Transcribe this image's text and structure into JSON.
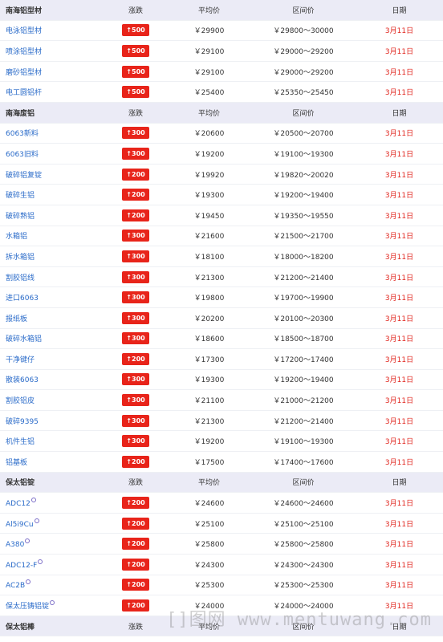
{
  "columns": {
    "change": "涨跌",
    "avg": "平均价",
    "range": "区间价",
    "date": "日期"
  },
  "sections": [
    {
      "title": "南海铝型材",
      "rows": [
        {
          "name": "电泳铝型材",
          "change": "↑500",
          "avg": "￥29900",
          "range": "￥29800～30000",
          "date": "3月11日"
        },
        {
          "name": "喷涂铝型材",
          "change": "↑500",
          "avg": "￥29100",
          "range": "￥29000～29200",
          "date": "3月11日"
        },
        {
          "name": "磨砂铝型材",
          "change": "↑500",
          "avg": "￥29100",
          "range": "￥29000～29200",
          "date": "3月11日"
        },
        {
          "name": "电工圆铝杆",
          "change": "↑500",
          "avg": "￥25400",
          "range": "￥25350～25450",
          "date": "3月11日"
        }
      ]
    },
    {
      "title": "南海废铝",
      "rows": [
        {
          "name": "6063新料",
          "change": "↑300",
          "avg": "￥20600",
          "range": "￥20500～20700",
          "date": "3月11日"
        },
        {
          "name": "6063旧料",
          "change": "↑300",
          "avg": "￥19200",
          "range": "￥19100～19300",
          "date": "3月11日"
        },
        {
          "name": "破碎铝复锭",
          "change": "↑200",
          "avg": "￥19920",
          "range": "￥19820～20020",
          "date": "3月11日"
        },
        {
          "name": "破碎生铝",
          "change": "↑200",
          "avg": "￥19300",
          "range": "￥19200～19400",
          "date": "3月11日"
        },
        {
          "name": "破碎熟铝",
          "change": "↑200",
          "avg": "￥19450",
          "range": "￥19350～19550",
          "date": "3月11日"
        },
        {
          "name": "水箱铝",
          "change": "↑300",
          "avg": "￥21600",
          "range": "￥21500～21700",
          "date": "3月11日"
        },
        {
          "name": "拆水箱铝",
          "change": "↑300",
          "avg": "￥18100",
          "range": "￥18000～18200",
          "date": "3月11日"
        },
        {
          "name": "割胶铝线",
          "change": "↑300",
          "avg": "￥21300",
          "range": "￥21200～21400",
          "date": "3月11日"
        },
        {
          "name": "进口6063",
          "change": "↑300",
          "avg": "￥19800",
          "range": "￥19700～19900",
          "date": "3月11日"
        },
        {
          "name": "报纸板",
          "change": "↑300",
          "avg": "￥20200",
          "range": "￥20100～20300",
          "date": "3月11日"
        },
        {
          "name": "破碎水箱铝",
          "change": "↑300",
          "avg": "￥18600",
          "range": "￥18500～18700",
          "date": "3月11日"
        },
        {
          "name": "干净键仔",
          "change": "↑200",
          "avg": "￥17300",
          "range": "￥17200～17400",
          "date": "3月11日"
        },
        {
          "name": "散装6063",
          "change": "↑300",
          "avg": "￥19300",
          "range": "￥19200～19400",
          "date": "3月11日"
        },
        {
          "name": "割胶铝皮",
          "change": "↑300",
          "avg": "￥21100",
          "range": "￥21000～21200",
          "date": "3月11日"
        },
        {
          "name": "破碎9395",
          "change": "↑300",
          "avg": "￥21300",
          "range": "￥21200～21400",
          "date": "3月11日"
        },
        {
          "name": "机件生铝",
          "change": "↑300",
          "avg": "￥19200",
          "range": "￥19100～19300",
          "date": "3月11日"
        },
        {
          "name": "铝基板",
          "change": "↑200",
          "avg": "￥17500",
          "range": "￥17400～17600",
          "date": "3月11日"
        }
      ]
    },
    {
      "title": "保太铝锭",
      "rows": [
        {
          "name": "ADC12",
          "change": "↑200",
          "avg": "￥24600",
          "range": "￥24600～24600",
          "date": "3月11日",
          "mark": true
        },
        {
          "name": "Al5i9Cu",
          "change": "↑200",
          "avg": "￥25100",
          "range": "￥25100～25100",
          "date": "3月11日",
          "mark": true
        },
        {
          "name": "A380",
          "change": "↑200",
          "avg": "￥25800",
          "range": "￥25800～25800",
          "date": "3月11日",
          "mark": true
        },
        {
          "name": "ADC12-F",
          "change": "↑200",
          "avg": "￥24300",
          "range": "￥24300～24300",
          "date": "3月11日",
          "mark": true
        },
        {
          "name": "AC2B",
          "change": "↑200",
          "avg": "￥25300",
          "range": "￥25300～25300",
          "date": "3月11日",
          "mark": true
        },
        {
          "name": "保太压铸铝锭",
          "change": "↑200",
          "avg": "￥24000",
          "range": "￥24000～24000",
          "date": "3月11日",
          "mark": true
        }
      ]
    },
    {
      "title": "保太铝棒",
      "rows": []
    }
  ],
  "watermark": "[]图网 www.mentuwang.com"
}
